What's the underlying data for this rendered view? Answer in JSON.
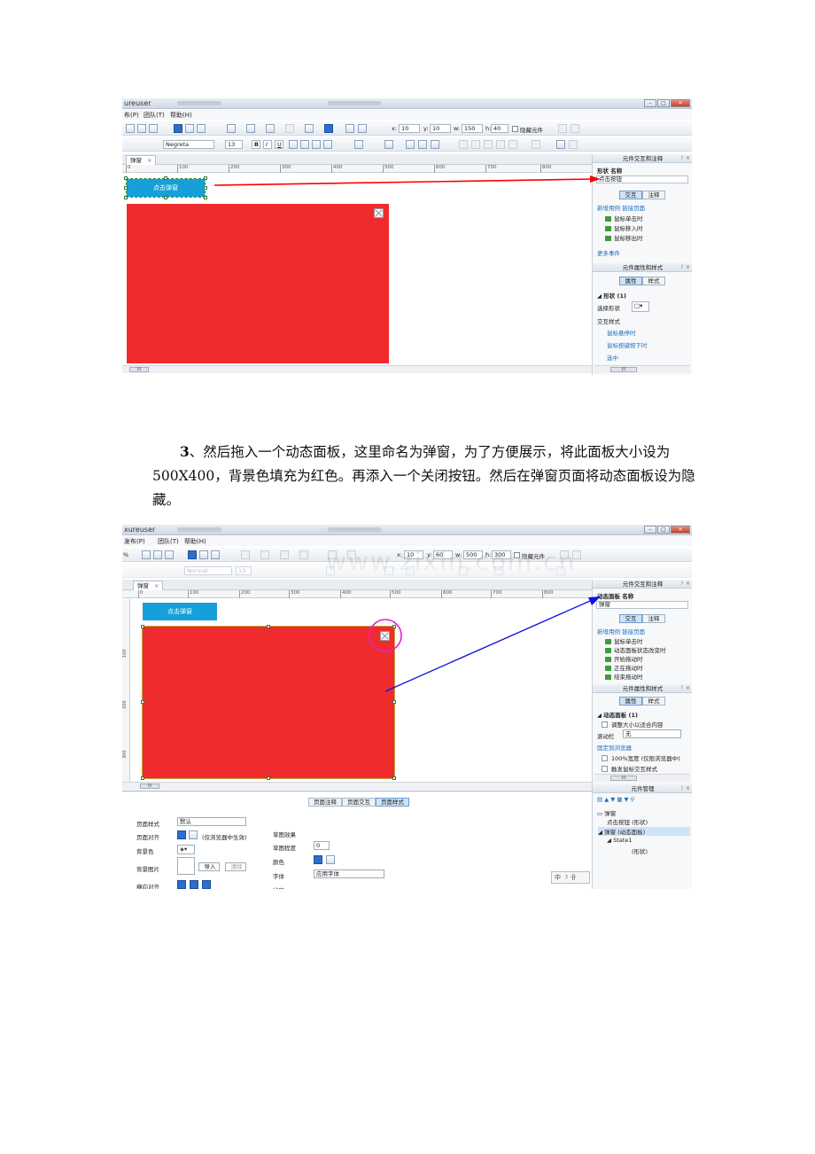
{
  "shot1": {
    "app_title": "ureuser",
    "menu": [
      "布(P)",
      "团队(T)",
      "帮助(H)"
    ],
    "toolbar": {
      "x_label": "x:",
      "x": "10",
      "y_label": "y:",
      "y": "10",
      "w_label": "w:",
      "w": "150",
      "h_label": "h:",
      "h": "40",
      "hide_label": "隐藏元件",
      "font": "Negreta",
      "font_size": "13",
      "bold": "B",
      "italic": "I",
      "underline": "U"
    },
    "tab": "弹窗",
    "ruler": [
      "0",
      "100",
      "200",
      "300",
      "400",
      "500",
      "600",
      "700",
      "800"
    ],
    "button_text": "点击弹窗",
    "scroll_thumb": "III",
    "panel_top": {
      "title": "元件交互和注释",
      "field_label": "形状 名称",
      "name_value": "点击按钮",
      "tabs": [
        "交互",
        "注释"
      ],
      "links": "新增用例  链接页面",
      "events": [
        "鼠标单击时",
        "鼠标移入时",
        "鼠标移出时"
      ],
      "more": "更多事件"
    },
    "panel_bottom": {
      "title": "元件属性和样式",
      "tabs": [
        "属性",
        "样式"
      ],
      "section": "◢ 形状 (1)",
      "select_shape": "选择形状",
      "interact_style": "交互样式",
      "links": [
        "鼠标悬停时",
        "鼠标按键按下时",
        "选中"
      ]
    }
  },
  "paragraph": {
    "num": "3",
    "text": "、然后拖入一个动态面板，这里命名为弹窗，为了方便展示，将此面板大小设为500X400，背景色填充为红色。再添入一个关闭按钮。然后在弹窗页面将动态面板设为隐藏。"
  },
  "shot2": {
    "app_title": "xureuser",
    "menu": [
      "发布(P)",
      "团队(T)",
      "帮助(H)"
    ],
    "toolbar": {
      "zoom": "%",
      "x_label": "x:",
      "x": "10",
      "y_label": "y:",
      "y": "60",
      "w_label": "w:",
      "w": "500",
      "h_label": "h:",
      "h": "300",
      "hide_label": "隐藏元件",
      "font": "Normal",
      "font_size": "13"
    },
    "watermark": "www.zixin.com.cn",
    "tab": "弹窗",
    "ruler": [
      "0",
      "100",
      "200",
      "300",
      "400",
      "500",
      "600",
      "700",
      "800"
    ],
    "vruler": [
      "100",
      "200",
      "300"
    ],
    "button_text": "点击弹窗",
    "scroll_thumb": "III",
    "panel_top": {
      "title": "元件交互和注释",
      "field_label": "动态面板 名称",
      "name_value": "弹窗",
      "tabs": [
        "交互",
        "注释"
      ],
      "links": "新增用例  链接页面",
      "events": [
        "鼠标单击时",
        "动态面板状态改变时",
        "开始拖动时",
        "正在拖动时",
        "结束拖动时"
      ]
    },
    "panel_mid": {
      "title": "元件属性和样式",
      "tabs": [
        "属性",
        "样式"
      ],
      "section": "◢ 动态面板 (1)",
      "fit": "调整大小以适合内容",
      "scroll_label": "滚动栏",
      "scroll_value": "无",
      "fixed": "固定到浏览器",
      "full": "100%宽度 (仅限浏览器中)",
      "trigger": "触发鼠标交互样式"
    },
    "panel_manager": {
      "title": "元件管理",
      "page": "弹窗",
      "items": [
        "点击按钮 (形状)",
        "◢ 弹窗 (动态面板)",
        "◢ State1",
        "(形状)"
      ]
    },
    "bottom": {
      "tabs": [
        "页面注释",
        "页面交互",
        "页面样式"
      ],
      "page_style_label": "页面样式",
      "page_style_value": "默认",
      "align_label": "页面对齐",
      "align_note": "(仅浏览器中生效)",
      "bg_color_label": "背景色",
      "bg_image_label": "背景图片",
      "import": "导入",
      "clear": "清除",
      "h_align_label": "横向对齐",
      "sketch_title": "草图效果",
      "sketch_label": "草图程度",
      "sketch_value": "0",
      "color_label": "颜色",
      "font_label": "字体",
      "font_value": "应用字体",
      "line_label": "线宽"
    },
    "ime": "中 ☽ 卝"
  },
  "colors": {
    "red_panel": "#ef2b2d",
    "button_blue": "#16a0d9",
    "arrow_red": "#ff0000",
    "arrow_blue": "#1010e0",
    "circle_magenta": "#e81ec8"
  }
}
